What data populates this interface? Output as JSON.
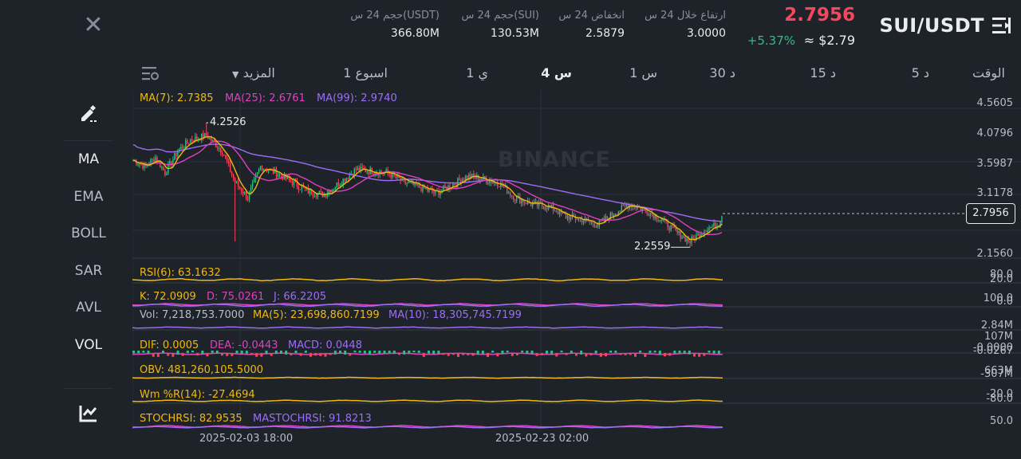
{
  "header": {
    "close_icon": "close-icon",
    "pair": "SUI/USDT",
    "menu_icon": "menu-list-icon",
    "last_price": "2.7956",
    "usd_price": "≈ $2.79",
    "change_pct": "+5.37%",
    "stats": [
      {
        "label": "ارتفاع خلال 24 س",
        "value": "3.0000"
      },
      {
        "label": "انخفاض 24 س",
        "value": "2.5879"
      },
      {
        "label": "حجم 24 س(SUI)",
        "value": "130.53M"
      },
      {
        "label": "حجم 24 س(USDT)",
        "value": "366.80M"
      }
    ]
  },
  "timeframes": {
    "settings_icon": "indicator-settings-icon",
    "more_label": "المزيد",
    "items": [
      {
        "label": "الوقت",
        "active": false
      },
      {
        "label": "5 د",
        "active": false
      },
      {
        "label": "15 د",
        "active": false
      },
      {
        "label": "30 د",
        "active": false
      },
      {
        "label": "1 س",
        "active": false
      },
      {
        "label": "4 س",
        "active": true
      },
      {
        "label": "1 ي",
        "active": false
      },
      {
        "label": "1 اسبوع",
        "active": false
      }
    ]
  },
  "sidebar": {
    "draw_icon": "drawing-tool-icon",
    "items": [
      "MA",
      "EMA",
      "BOLL",
      "SAR",
      "AVL",
      "VOL"
    ],
    "active": [
      "MA",
      "VOL"
    ],
    "bottom_icon": "chart-type-icon"
  },
  "chart": {
    "watermark": "BINANCE",
    "current_price": "2.7956",
    "high_label": "4.2526",
    "low_label": "2.2559",
    "price_axis": [
      "4.5605",
      "4.0796",
      "3.5987",
      "3.1178",
      "2.1560"
    ],
    "x_labels": [
      "2025-02-03 18:00",
      "2025-02-23 02:00"
    ],
    "colors": {
      "up": "#2ebd85",
      "down": "#f6465d",
      "ma7": "#f0b90b",
      "ma25": "#e040c0",
      "ma99": "#9c6ef5"
    },
    "ma_legend": [
      {
        "text": "MA(7): 2.7385",
        "color": "#f0b90b"
      },
      {
        "text": "MA(25): 2.6761",
        "color": "#e040c0"
      },
      {
        "text": "MA(99): 2.9740",
        "color": "#9c6ef5"
      }
    ],
    "indicators": [
      {
        "name": "rsi",
        "labels": [
          {
            "text": "RSI(6): 63.1632",
            "color": "#f0b90b"
          }
        ],
        "axis": [
          "80.0",
          "20.0"
        ]
      },
      {
        "name": "kdj",
        "labels": [
          {
            "text": "K: 72.0909",
            "color": "#f0b90b"
          },
          {
            "text": "D: 75.0261",
            "color": "#e040c0"
          },
          {
            "text": "J: 66.2205",
            "color": "#9c6ef5"
          }
        ],
        "axis": [
          "100.0",
          "0.0"
        ]
      },
      {
        "name": "vol",
        "labels": [
          {
            "text": "Vol: 7,218,753.7000",
            "color": "#b7bdc6"
          },
          {
            "text": "MA(5): 23,698,860.7199",
            "color": "#f0b90b"
          },
          {
            "text": "MA(10): 18,305,745.7199",
            "color": "#9c6ef5"
          }
        ],
        "axis": [
          "2.84M"
        ]
      },
      {
        "name": "macd",
        "labels": [
          {
            "text": "DIF: 0.0005",
            "color": "#f0b90b"
          },
          {
            "text": "DEA: -0.0443",
            "color": "#e040c0"
          },
          {
            "text": "MACD: 0.0448",
            "color": "#9c6ef5"
          }
        ],
        "axis": [
          "107M",
          "-0.0000",
          "-0.0267"
        ]
      },
      {
        "name": "obv",
        "labels": [
          {
            "text": "OBV: 481,260,105.5000",
            "color": "#f0b90b"
          }
        ],
        "axis": [
          "663M",
          "-307M"
        ]
      },
      {
        "name": "wr",
        "labels": [
          {
            "text": "Wm %R(14): -27.4694",
            "color": "#f0b90b"
          }
        ],
        "axis": [
          "-20.0",
          "-80.0"
        ]
      },
      {
        "name": "stochrsi",
        "labels": [
          {
            "text": "STOCHRSI: 82.9535",
            "color": "#f0b90b"
          },
          {
            "text": "MASTOCHRSI: 91.8213",
            "color": "#9c6ef5"
          }
        ],
        "axis": [
          "50.0"
        ]
      }
    ]
  }
}
